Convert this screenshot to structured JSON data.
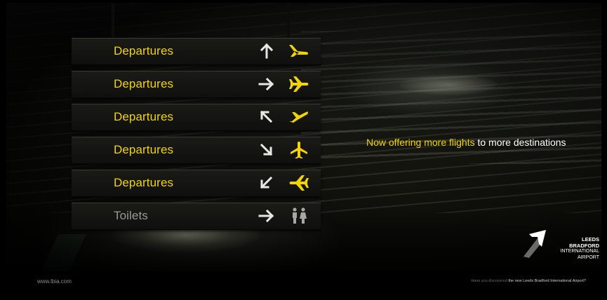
{
  "signs": [
    {
      "label": "Departures",
      "arrow": "arrow-up-icon",
      "icon": "plane-departure-icon"
    },
    {
      "label": "Departures",
      "arrow": "arrow-right-icon",
      "icon": "plane-right-icon"
    },
    {
      "label": "Departures",
      "arrow": "arrow-up-left-icon",
      "icon": "plane-landing-icon"
    },
    {
      "label": "Departures",
      "arrow": "arrow-down-right-icon",
      "icon": "plane-up-icon"
    },
    {
      "label": "Departures",
      "arrow": "arrow-down-left-icon",
      "icon": "plane-left-icon"
    },
    {
      "label": "Toilets",
      "arrow": "arrow-right-icon",
      "icon": "toilets-icon"
    }
  ],
  "tagline": {
    "highlight": "Now offering more flights",
    "rest": " to more destinations"
  },
  "logo": {
    "line1": "LEEDS",
    "line2": "BRADFORD",
    "line3": "INTERNATIONAL",
    "line4": "AIRPORT"
  },
  "footer": {
    "url": "www.lbia.com",
    "note_prefix": "Have you discovered ",
    "note_emphasis": "the new Leeds Bradford International Airport?"
  },
  "colors": {
    "sign_yellow": "#f2d400",
    "sign_grey": "#9a9a94",
    "background": "#000000"
  }
}
